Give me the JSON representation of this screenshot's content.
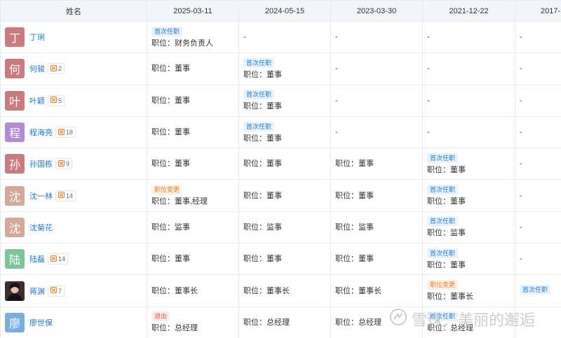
{
  "table": {
    "header": [
      "姓名",
      "2025-03-11",
      "2024-05-15",
      "2023-03-30",
      "2021-12-22",
      "2017-"
    ],
    "rows": [
      {
        "avatar_char": "丁",
        "avatar_color": "#c97b80",
        "name": "丁琍",
        "badge": null,
        "cells": [
          {
            "tag": "首次任职",
            "tag_type": "first",
            "pos": "职位：财务负责人"
          },
          {
            "dash": "-"
          },
          {
            "dash": "-"
          },
          {
            "dash": "-"
          },
          {
            "dash": "-"
          }
        ]
      },
      {
        "avatar_char": "何",
        "avatar_color": "#c97b80",
        "name": "何骏",
        "badge": "2",
        "cells": [
          {
            "pos": "职位：董事"
          },
          {
            "tag": "首次任职",
            "tag_type": "first",
            "pos": "职位：董事"
          },
          {
            "dash": "-"
          },
          {
            "dash": "-"
          },
          {
            "dash": "-"
          }
        ]
      },
      {
        "avatar_char": "叶",
        "avatar_color": "#c97b80",
        "name": "叶颖",
        "badge": "5",
        "cells": [
          {
            "pos": "职位：董事"
          },
          {
            "tag": "首次任职",
            "tag_type": "first",
            "pos": "职位：董事"
          },
          {
            "dash": "-"
          },
          {
            "dash": "-"
          },
          {
            "dash": "-"
          }
        ]
      },
      {
        "avatar_char": "程",
        "avatar_color": "#b38bd0",
        "name": "程海亮",
        "badge": "18",
        "cells": [
          {
            "pos": "职位：董事"
          },
          {
            "tag": "首次任职",
            "tag_type": "first",
            "pos": "职位：董事"
          },
          {
            "dash": "-"
          },
          {
            "dash": "-"
          },
          {
            "dash": "-"
          }
        ]
      },
      {
        "avatar_char": "孙",
        "avatar_color": "#c97b80",
        "name": "孙国栋",
        "badge": "9",
        "cells": [
          {
            "pos": "职位：董事"
          },
          {
            "pos": "职位：董事"
          },
          {
            "pos": "职位：董事"
          },
          {
            "tag": "首次任职",
            "tag_type": "first",
            "pos": "职位：董事"
          },
          {
            "dash": "-"
          }
        ]
      },
      {
        "avatar_char": "沈",
        "avatar_color": "#d4a99a",
        "name": "沈一林",
        "badge": "14",
        "cells": [
          {
            "tag": "职位变更",
            "tag_type": "change",
            "pos": "职位：董事,经理"
          },
          {
            "pos": "职位：董事"
          },
          {
            "pos": "职位：董事"
          },
          {
            "tag": "首次任职",
            "tag_type": "first",
            "pos": "职位：董事"
          },
          {
            "dash": "-"
          }
        ]
      },
      {
        "avatar_char": "沈",
        "avatar_color": "#d4a99a",
        "name": "沈菊花",
        "badge": null,
        "cells": [
          {
            "pos": "职位：监事"
          },
          {
            "pos": "职位：监事"
          },
          {
            "pos": "职位：监事"
          },
          {
            "tag": "首次任职",
            "tag_type": "first",
            "pos": "职位：监事"
          },
          {
            "dash": "-"
          }
        ]
      },
      {
        "avatar_char": "陆",
        "avatar_color": "#7cc49a",
        "name": "陆磊",
        "badge": "14",
        "cells": [
          {
            "pos": "职位：董事"
          },
          {
            "pos": "职位：董事"
          },
          {
            "pos": "职位：董事"
          },
          {
            "tag": "首次任职",
            "tag_type": "first",
            "pos": "职位：董事"
          },
          {
            "dash": "-"
          }
        ]
      },
      {
        "avatar_char": "",
        "avatar_color": "#2a2a2a",
        "avatar_photo": true,
        "name": "蒋渊",
        "badge": "7",
        "cells": [
          {
            "pos": "职位：董事长"
          },
          {
            "pos": "职位：董事长"
          },
          {
            "pos": "职位：董事长"
          },
          {
            "tag": "职位变更",
            "tag_type": "change",
            "pos": "职位：董事长"
          },
          {
            "tag": "首次任职",
            "tag_type": "first",
            "pos": ""
          }
        ]
      },
      {
        "avatar_char": "廖",
        "avatar_color": "#7aaede",
        "name": "廖世保",
        "badge": null,
        "cells": [
          {
            "tag": "退出",
            "tag_type": "exit",
            "pos": "职位：总经理"
          },
          {
            "pos": "职位：总经理"
          },
          {
            "pos": "职位：总经理"
          },
          {
            "tag": "首次任职",
            "tag_type": "first",
            "pos": "职位：总经理"
          },
          {
            "dash": ""
          }
        ]
      }
    ]
  },
  "watermark": "雪球：美丽的邂逅",
  "colors": {
    "link": "#1f78d1",
    "header_bg": "#f2f6fb",
    "border": "#e8ebef"
  }
}
